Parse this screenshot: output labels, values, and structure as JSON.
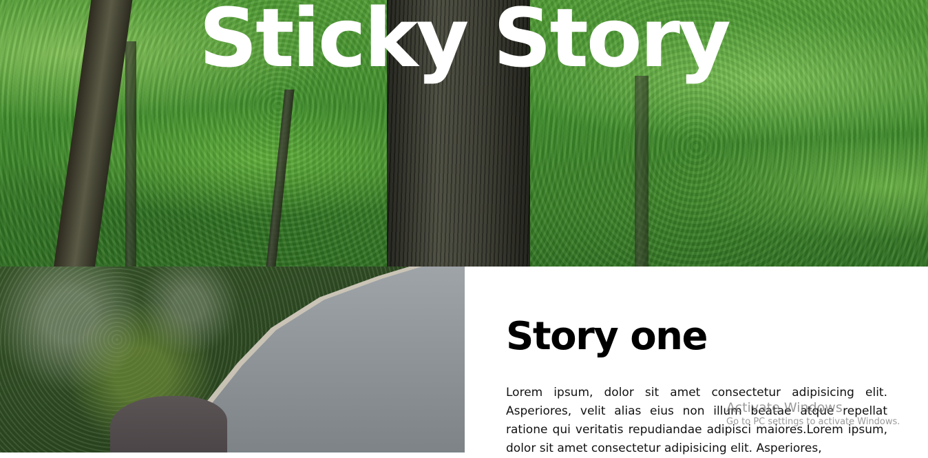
{
  "hero": {
    "title": "Sticky Story",
    "image": "forest-trees-photo"
  },
  "story_one": {
    "image": "coastal-aerial-photo",
    "title": "Story one",
    "body": "Lorem ipsum, dolor sit amet consectetur adipisicing elit. Asperiores, velit alias eius non illum beatae atque repellat ratione qui veritatis repudiandae adipisci maiores.Lorem ipsum, dolor sit amet consectetur adipisicing elit. Asperiores,"
  },
  "watermark": {
    "title": "Activate Windows",
    "subtitle": "Go to PC settings to activate Windows."
  }
}
